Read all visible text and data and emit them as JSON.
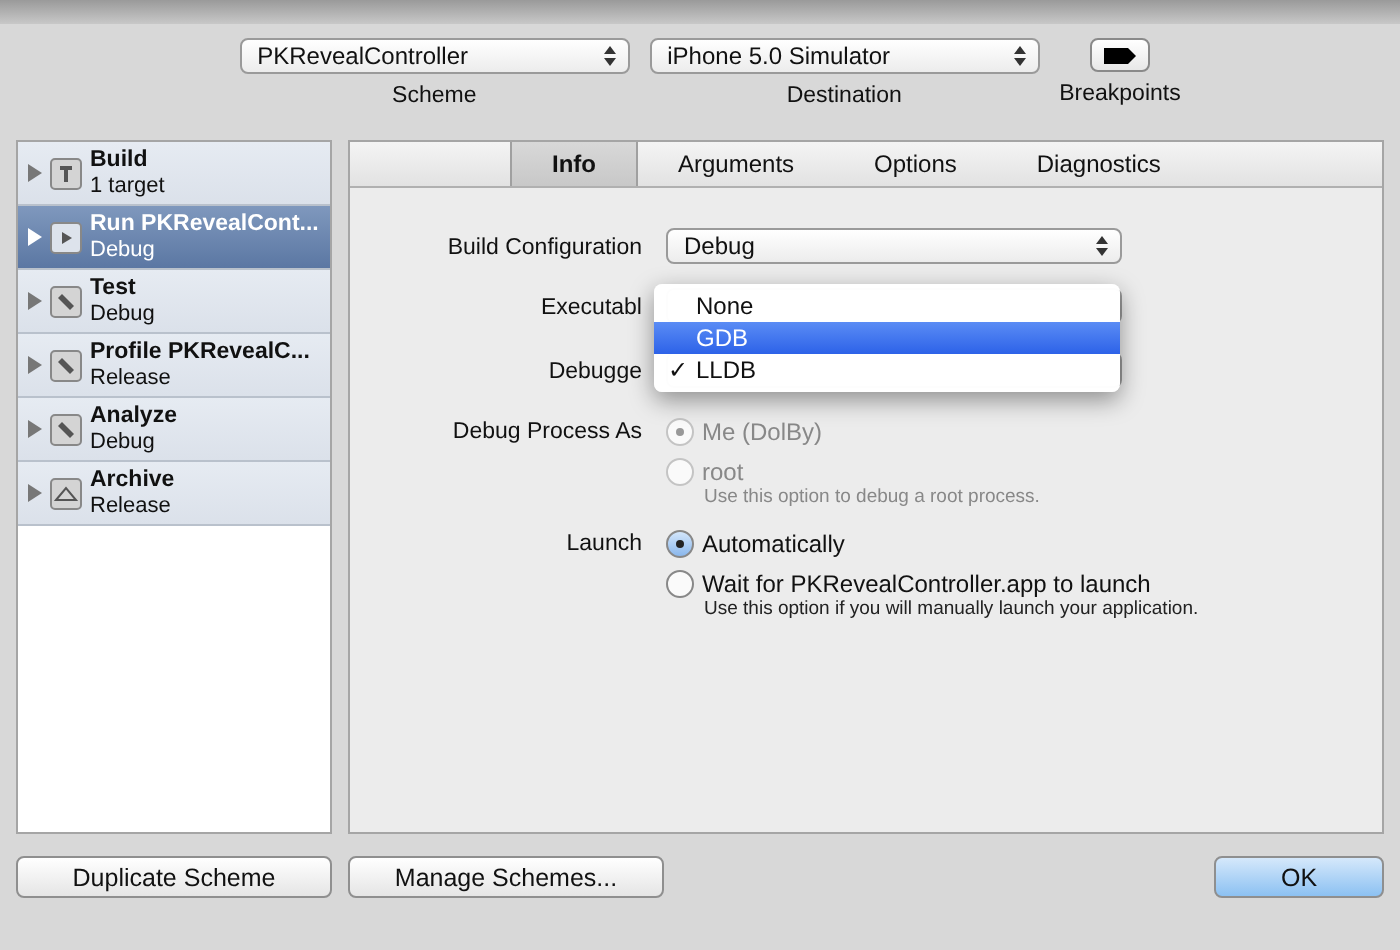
{
  "toolbar": {
    "scheme": {
      "value": "PKRevealController",
      "label": "Scheme"
    },
    "destination": {
      "value": "iPhone 5.0 Simulator",
      "label": "Destination"
    },
    "breakpoints": {
      "label": "Breakpoints",
      "on": true
    }
  },
  "sidebar": {
    "items": [
      {
        "title": "Build",
        "subtitle": "1 target",
        "kind": "hammer",
        "selected": false
      },
      {
        "title": "Run PKRevealCont...",
        "subtitle": "Debug",
        "kind": "play",
        "selected": true
      },
      {
        "title": "Test",
        "subtitle": "Debug",
        "kind": "wrench",
        "selected": false
      },
      {
        "title": "Profile PKRevealC...",
        "subtitle": "Release",
        "kind": "wrench",
        "selected": false
      },
      {
        "title": "Analyze",
        "subtitle": "Debug",
        "kind": "wrench",
        "selected": false
      },
      {
        "title": "Archive",
        "subtitle": "Release",
        "kind": "archive",
        "selected": false
      }
    ]
  },
  "tabs": [
    {
      "label": "Info",
      "selected": true
    },
    {
      "label": "Arguments",
      "selected": false
    },
    {
      "label": "Options",
      "selected": false
    },
    {
      "label": "Diagnostics",
      "selected": false
    }
  ],
  "form": {
    "build_configuration": {
      "label": "Build Configuration",
      "value": "Debug"
    },
    "executable": {
      "label": "Executabl"
    },
    "debugger": {
      "label": "Debugge"
    },
    "debug_process_as": {
      "label": "Debug Process As",
      "options": [
        {
          "label": "Me (DolBy)",
          "selected": true,
          "disabled": true
        },
        {
          "label": "root",
          "hint": "Use this option to debug a root process.",
          "selected": false,
          "disabled": true
        }
      ]
    },
    "launch": {
      "label": "Launch",
      "options": [
        {
          "label": "Automatically",
          "selected": true,
          "disabled": false
        },
        {
          "label": "Wait for PKRevealController.app to launch",
          "hint": "Use this option if you will manually launch your application.",
          "selected": false,
          "disabled": false
        }
      ]
    }
  },
  "menu": {
    "items": [
      {
        "label": "None",
        "highlighted": false,
        "checked": false
      },
      {
        "label": "GDB",
        "highlighted": true,
        "checked": false
      },
      {
        "label": "LLDB",
        "highlighted": false,
        "checked": true
      }
    ]
  },
  "check_mark": "✓",
  "buttons": {
    "duplicate": "Duplicate Scheme",
    "manage": "Manage Schemes...",
    "ok": "OK"
  }
}
